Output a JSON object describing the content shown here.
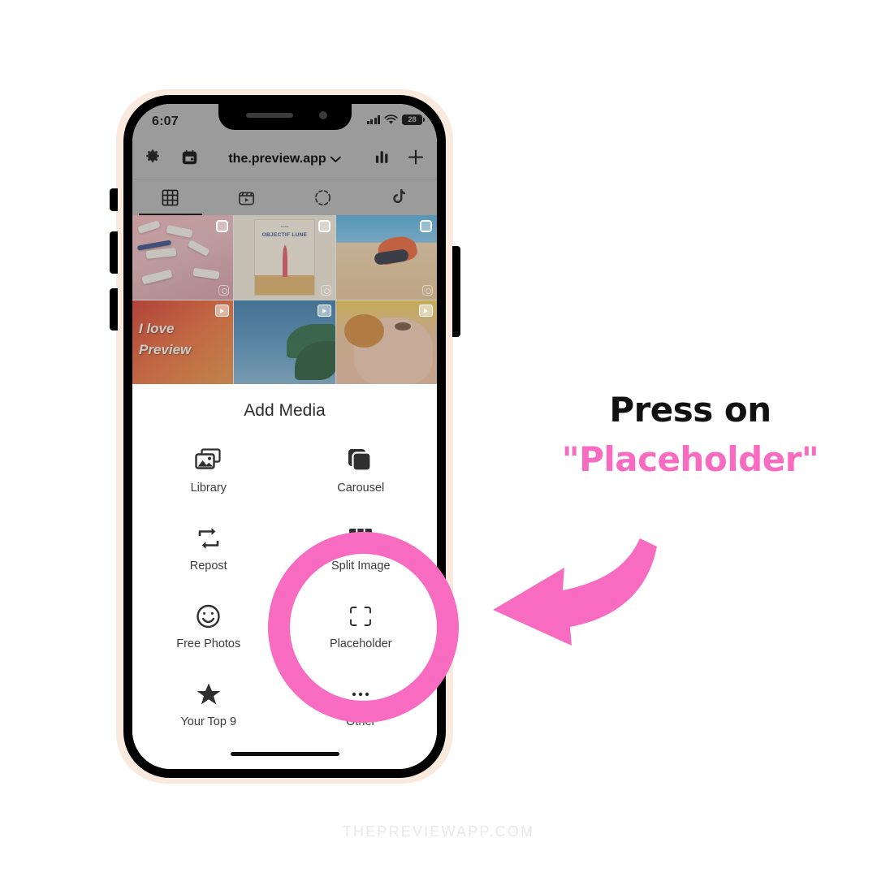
{
  "phone": {
    "status_bar": {
      "time": "6:07",
      "cellular_icon": "signal-bars-icon",
      "wifi_icon": "wifi-icon",
      "battery_level": "28"
    },
    "ig_nav": {
      "gear_icon": "gear-icon",
      "calendar_icon": "calendar-icon",
      "account_name": "the.preview.app",
      "chevron_icon": "chevron-down-icon",
      "analytics_icon": "bar-chart-icon",
      "add_icon": "plus-icon"
    },
    "ig_tabs": [
      {
        "name": "grid",
        "icon": "grid-icon",
        "active": true
      },
      {
        "name": "reels",
        "icon": "reels-icon",
        "active": false
      },
      {
        "name": "stories",
        "icon": "dashed-circle-icon",
        "active": false
      },
      {
        "name": "tiktok",
        "icon": "tiktok-note-icon",
        "active": false
      }
    ],
    "grid_cells": [
      {
        "id": "c1",
        "desc": "paint tubes on pink backdrop",
        "badge": "multi-select-checkbox",
        "corner": "instagram-icon"
      },
      {
        "id": "c2",
        "desc": "Objectif Lune book cover",
        "badge": "multi-select-checkbox",
        "corner": "instagram-icon",
        "caption": "OBJECTIF LUNE",
        "caption_sub": "TINTIN"
      },
      {
        "id": "c3",
        "desc": "person lying on sand dune",
        "badge": "multi-select-checkbox",
        "corner": "instagram-icon"
      },
      {
        "id": "c4",
        "desc": "I love Preview reel",
        "badge": "reel-badge",
        "caption": "I love\nPreview"
      },
      {
        "id": "c5",
        "desc": "palm tree sky reel",
        "badge": "reel-badge"
      },
      {
        "id": "c6",
        "desc": "face with pastry reel",
        "badge": "reel-badge"
      }
    ],
    "sheet": {
      "title": "Add Media",
      "items": [
        {
          "label": "Library",
          "icon": "photo-library-icon"
        },
        {
          "label": "Carousel",
          "icon": "stacked-squares-icon"
        },
        {
          "label": "Repost",
          "icon": "repost-arrows-icon"
        },
        {
          "label": "Split Image",
          "icon": "split-columns-icon"
        },
        {
          "label": "Free Photos",
          "icon": "smiley-face-icon"
        },
        {
          "label": "Placeholder",
          "icon": "crop-frame-icon"
        },
        {
          "label": "Your Top 9",
          "icon": "star-icon"
        },
        {
          "label": "Other",
          "icon": "ellipsis-icon"
        }
      ],
      "home_indicator": "home-indicator"
    }
  },
  "annotation": {
    "line1": "Press on",
    "line2": "\"Placeholder\"",
    "arrow": "curved-arrow-left-icon",
    "highlight": "circle-highlight",
    "accent_color": "#f76cc0",
    "text_color": "#111111"
  },
  "watermark": "THEPREVIEWAPP.COM"
}
